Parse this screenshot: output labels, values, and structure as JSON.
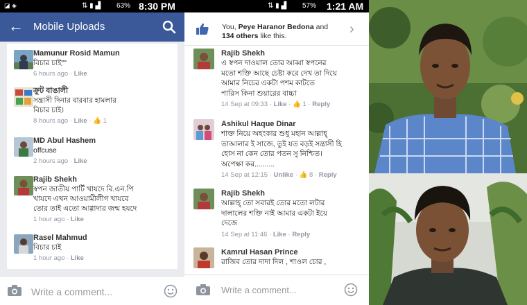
{
  "left_panel": {
    "status": {
      "time": "8:30 PM",
      "battery": "63%"
    },
    "header": {
      "title": "Mobile Uploads"
    },
    "comments": [
      {
        "name": "Mamunur Rosid Mamun",
        "text": [
          "বিচার চাই\"\""
        ],
        "time": "6 hours ago",
        "like": "Like",
        "reactions": ""
      },
      {
        "name": "ক্রুট বাঙালী",
        "text": [
          "সন্ত্রাসী দিনার বারবার হামলার",
          "বিচার চাই।"
        ],
        "time": "8 hours ago",
        "like": "Like",
        "reactions": "1"
      },
      {
        "name": "MD Abul Hashem",
        "text": [
          "offcuse"
        ],
        "time": "2 hours ago",
        "like": "Like",
        "reactions": ""
      },
      {
        "name": "Rajib Shekh",
        "text": [
          "স্বপন জাতীয় পার্টি খাযদে বি.এন.পি",
          "খাযদে এখন আওয়ামীলীগ খাযবে",
          "তোর তাই এতো আগ্গাদার জন্ম হযদে"
        ],
        "time": "1 hour ago",
        "like": "Like",
        "reactions": ""
      },
      {
        "name": "Rasel Mahmud",
        "text": [
          "বিচার চাই"
        ],
        "time": "1 hour ago",
        "like": "Like",
        "reactions": ""
      }
    ],
    "composer": {
      "placeholder": "Write a comment..."
    }
  },
  "middle_panel": {
    "status": {
      "time": "1:21 AM",
      "battery": "57%"
    },
    "likes": {
      "prefix": "You,",
      "name": "Peye Haranor Bedona",
      "and": "and",
      "others": "134 others",
      "suffix": "like this."
    },
    "comments": [
      {
        "name": "Rajib Shekh",
        "text": [
          "এ স্বপন দাওয়াল তোর আব্বা স্বপনের",
          "মতো শক্তি আছে চেষ্টা করে দেখ তা দিয়ে",
          "আমার নিচের একটা পশম কাটতে",
          "পারিস কিনা শুয়ারের বাচ্চা"
        ],
        "date": "14 Sep at 09:33",
        "like": "Like",
        "reactions": "1",
        "reply": "Reply"
      },
      {
        "name": "Ashikul Haque Dinar",
        "text": [
          "শাক্ত নিয়ে অহংকার শুধু মহান আল্লাহ্‌",
          "তাআলার ই সাজে, তুই যত বড়ই সন্ত্রাসী হি",
          "হোস না কেন তোর পতন সু নিশ্চিত।",
          "অপেক্ষা কর.........."
        ],
        "date": "14 Sep at 12:15",
        "like": "Unlike",
        "reactions": "8",
        "reply": "Reply"
      },
      {
        "name": "Rajib Shekh",
        "text": [
          "আল্লাহ্‌ তো সবারই তোর মতো লটার",
          "দালালের শক্তি নাই আমার একটা ইয়ে",
          "দেজে"
        ],
        "date": "14 Sep at 11:46",
        "like": "Like",
        "reactions": "",
        "reply": "Reply"
      },
      {
        "name": "Kamrul Hasan Prince",
        "text": [
          "রাজিব তোর দাদা দিল , শাওল চোর ,"
        ],
        "date": "",
        "like": "",
        "reactions": "",
        "reply": ""
      }
    ],
    "composer": {
      "placeholder": "Write a comment..."
    }
  }
}
